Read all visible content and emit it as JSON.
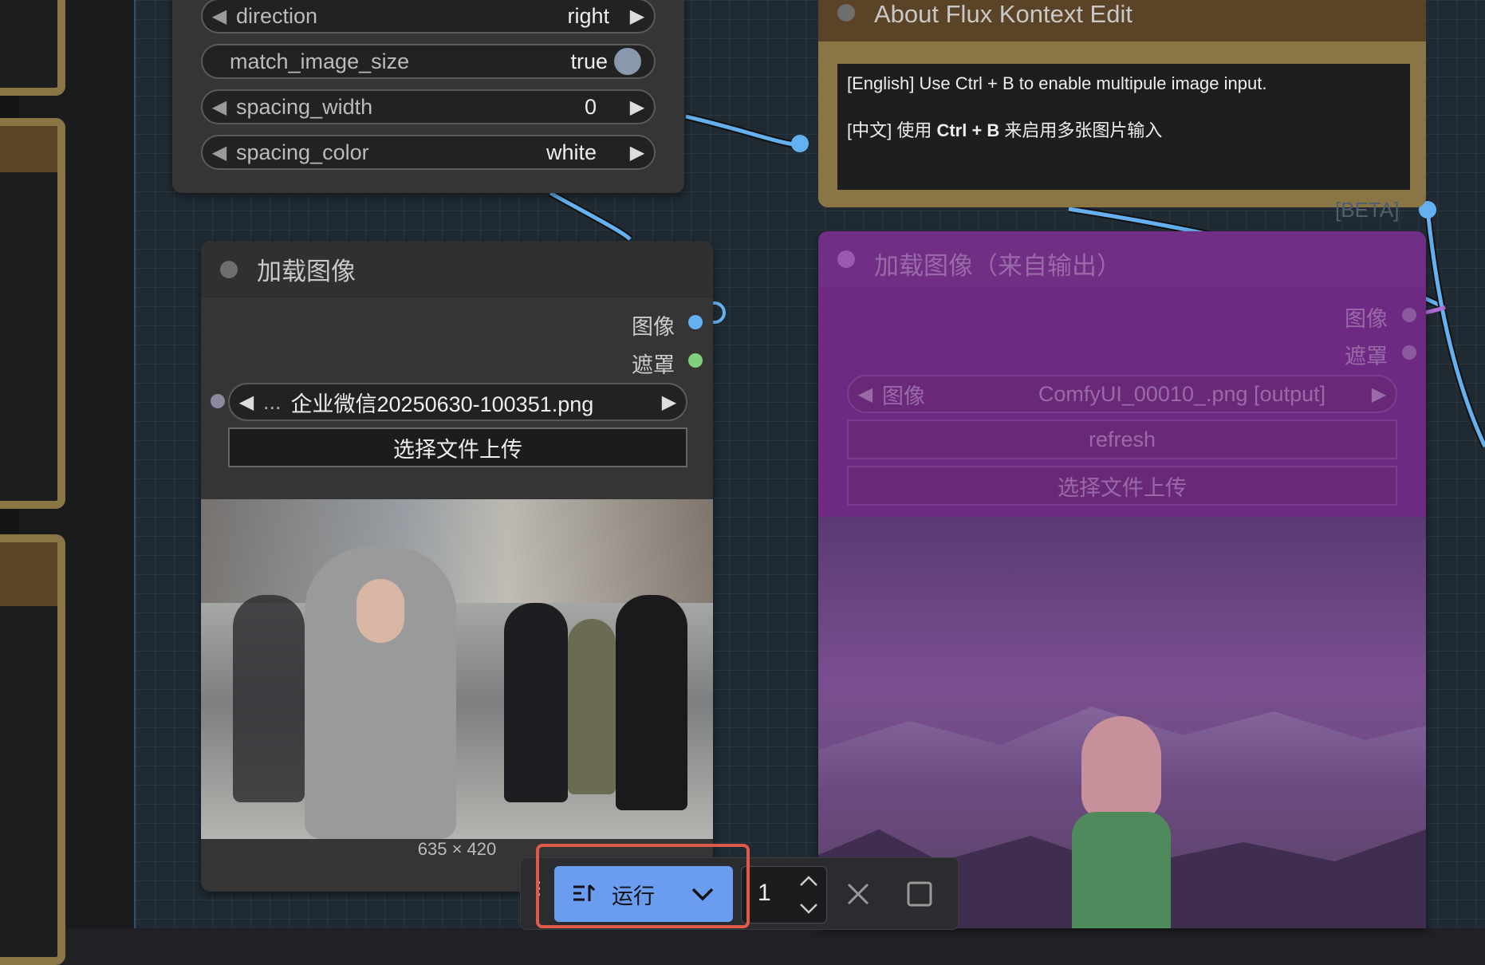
{
  "image_size_node": {
    "widgets": [
      {
        "label": "direction",
        "value": "right"
      },
      {
        "label": "match_image_size",
        "value": "true"
      },
      {
        "label": "spacing_width",
        "value": "0"
      },
      {
        "label": "spacing_color",
        "value": "white"
      }
    ]
  },
  "about_node": {
    "title": "About Flux Kontext Edit",
    "line_en": "[English] Use Ctrl + B to enable multipule image input.",
    "line_zh_prefix": "[中文] 使用 ",
    "line_zh_keys": "Ctrl + B",
    "line_zh_suffix": " 来启用多张图片输入",
    "beta_tag": "[BETA]"
  },
  "load_image_node": {
    "title": "加载图像",
    "outputs": [
      "图像",
      "遮罩"
    ],
    "file_select": {
      "ellipsis": "...",
      "value": "企业微信20250630-100351.png"
    },
    "upload_label": "选择文件上传",
    "image_size": "635 × 420"
  },
  "load_output_node": {
    "title": "加载图像（来自输出）",
    "outputs": [
      "图像",
      "遮罩"
    ],
    "file_select": {
      "label": "图像",
      "value": "ComfyUI_00010_.png [output]"
    },
    "refresh_label": "refresh",
    "upload_label": "选择文件上传"
  },
  "toolbar": {
    "run_label": "运行",
    "count": "1"
  },
  "colors": {
    "wire_blue": "#64b0f0",
    "run_blue": "#6a9cf0",
    "group_gold": "#8a7544",
    "bypass_purple": "#8a2fa0",
    "highlight_red": "#e05a4a"
  },
  "icons": {
    "arrow_left": "triangle-left-icon",
    "arrow_right": "triangle-right-icon",
    "run": "queue-run-icon",
    "dropdown": "chevron-down-icon",
    "increment": "chevron-up-icon",
    "decrement": "chevron-down-icon",
    "close": "close-icon",
    "stop": "square-stop-icon",
    "drag": "drag-handle-icon"
  }
}
